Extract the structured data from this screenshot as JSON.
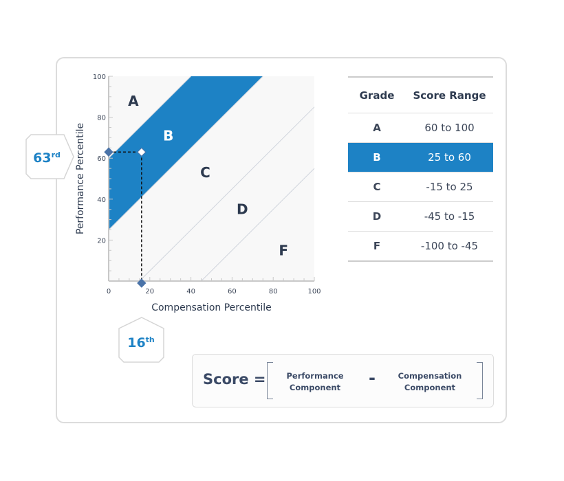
{
  "chart_data": {
    "type": "area",
    "xlabel": "Compensation Percentile",
    "ylabel": "Performance Percentile",
    "xlim": [
      0,
      100
    ],
    "ylim": [
      0,
      100
    ],
    "x_ticks": [
      "0",
      "20",
      "40",
      "60",
      "80",
      "100"
    ],
    "y_ticks": [
      "20",
      "40",
      "60",
      "80",
      "100"
    ],
    "grade_bands": [
      {
        "grade": "A",
        "lower_offset": 60
      },
      {
        "grade": "B",
        "lower_offset": 25,
        "upper_offset": 60,
        "highlighted": true
      },
      {
        "grade": "C",
        "lower_offset": -15,
        "upper_offset": 25
      },
      {
        "grade": "D",
        "lower_offset": -45,
        "upper_offset": -15
      },
      {
        "grade": "F",
        "upper_offset": -45
      }
    ],
    "grade_labels": [
      {
        "text": "A",
        "x": 12,
        "y": 88
      },
      {
        "text": "B",
        "x": 29,
        "y": 71
      },
      {
        "text": "C",
        "x": 47,
        "y": 53
      },
      {
        "text": "D",
        "x": 65,
        "y": 35
      },
      {
        "text": "F",
        "x": 85,
        "y": 15
      }
    ],
    "point": {
      "x": 16,
      "y": 63
    },
    "colors": {
      "highlight": "#1d82c5",
      "marker": "#4a73a8",
      "plot_bg": "#f8f8f8"
    }
  },
  "badges": {
    "performance": {
      "value": "63",
      "suffix": "rd"
    },
    "compensation": {
      "value": "16",
      "suffix": "th"
    }
  },
  "table": {
    "headers": [
      "Grade",
      "Score Range"
    ],
    "rows": [
      {
        "grade": "A",
        "range": "60 to 100"
      },
      {
        "grade": "B",
        "range": "25 to 60"
      },
      {
        "grade": "C",
        "range": "-15 to 25"
      },
      {
        "grade": "D",
        "range": "-45 to -15"
      },
      {
        "grade": "F",
        "range": "-100 to -45"
      }
    ],
    "highlighted_grade": "B"
  },
  "formula": {
    "lhs": "Score =",
    "left_line1": "Performance",
    "left_line2": "Component",
    "operator": "-",
    "right_line1": "Compensation",
    "right_line2": "Component"
  }
}
